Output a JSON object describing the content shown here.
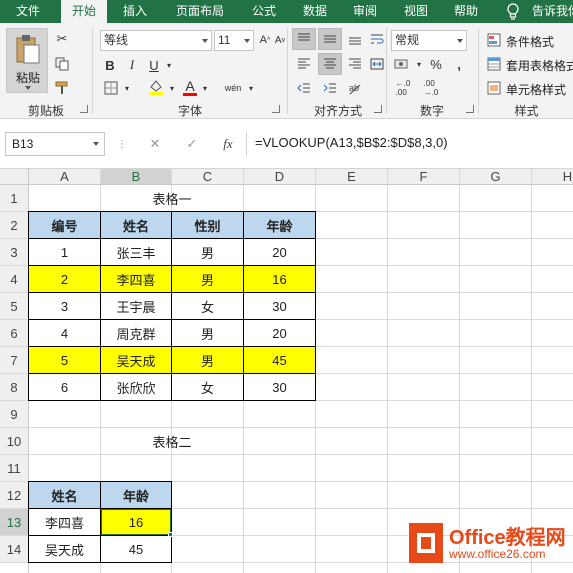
{
  "tabs": [
    {
      "label": "文件",
      "active": false
    },
    {
      "label": "开始",
      "active": true
    },
    {
      "label": "插入",
      "active": false
    },
    {
      "label": "页面布局",
      "active": false
    },
    {
      "label": "公式",
      "active": false
    },
    {
      "label": "数据",
      "active": false
    },
    {
      "label": "审阅",
      "active": false
    },
    {
      "label": "视图",
      "active": false
    },
    {
      "label": "帮助",
      "active": false
    }
  ],
  "tell_me": "告诉我你",
  "ribbon": {
    "paste_label": "粘贴",
    "font_name": "等线",
    "font_size": "11",
    "bold": "B",
    "italic": "I",
    "underline": "U",
    "font_color_glyph": "A",
    "phonetic_glyph": "wén",
    "number_format": "常规",
    "percent": "%",
    "comma": ",",
    "conditional_format": "条件格式",
    "table_format": "套用表格格式",
    "cell_style": "单元格样式",
    "groups": {
      "clipboard": "剪贴板",
      "font": "字体",
      "alignment": "对齐方式",
      "number": "数字",
      "styles": "样式"
    }
  },
  "formula_bar": {
    "name_box": "B13",
    "cancel": "✕",
    "enter": "✓",
    "fx": "fx",
    "formula": "=VLOOKUP(A13,$B$2:$D$8,3,0)"
  },
  "columns": [
    "A",
    "B",
    "C",
    "D",
    "E",
    "F",
    "G",
    "H"
  ],
  "rows": [
    "1",
    "2",
    "3",
    "4",
    "5",
    "6",
    "7",
    "8",
    "9",
    "10",
    "11",
    "12",
    "13",
    "14"
  ],
  "table1": {
    "title": "表格一",
    "headers": [
      "编号",
      "姓名",
      "性别",
      "年龄"
    ],
    "rows": [
      [
        "1",
        "张三丰",
        "男",
        "20"
      ],
      [
        "2",
        "李四喜",
        "男",
        "16"
      ],
      [
        "3",
        "王宇晨",
        "女",
        "30"
      ],
      [
        "4",
        "周克群",
        "男",
        "20"
      ],
      [
        "5",
        "吴天成",
        "男",
        "45"
      ],
      [
        "6",
        "张欣欣",
        "女",
        "30"
      ]
    ],
    "highlighted_rows": [
      1,
      4
    ]
  },
  "table2": {
    "title": "表格二",
    "headers": [
      "姓名",
      "年龄"
    ],
    "rows": [
      [
        "李四喜",
        "16"
      ],
      [
        "吴天成",
        "45"
      ]
    ]
  },
  "watermark": {
    "title": "Office教程网",
    "url": "www.office26.com"
  },
  "colors": {
    "excel_green": "#217346",
    "highlight": "#ffff00",
    "header_fill": "#bdd7ee",
    "watermark": "#e64a19"
  }
}
